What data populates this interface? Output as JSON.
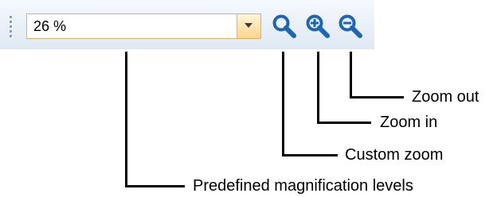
{
  "toolbar": {
    "zoom_value": "26 %",
    "icons": {
      "grip": "grip-icon",
      "dropdown": "chevron-down-icon",
      "custom_zoom": "magnifier-icon",
      "zoom_in": "zoom-in-icon",
      "zoom_out": "zoom-out-icon"
    },
    "colors": {
      "combo_border": "#e1b25c",
      "dropdown_bg": "#ffd58a",
      "icon_blue": "#1f66b0",
      "toolbar_bg": "#dfe8f3"
    }
  },
  "callouts": {
    "zoom_out": "Zoom out",
    "zoom_in": "Zoom in",
    "custom_zoom": "Custom zoom",
    "predefined": "Predefined magnification levels"
  }
}
